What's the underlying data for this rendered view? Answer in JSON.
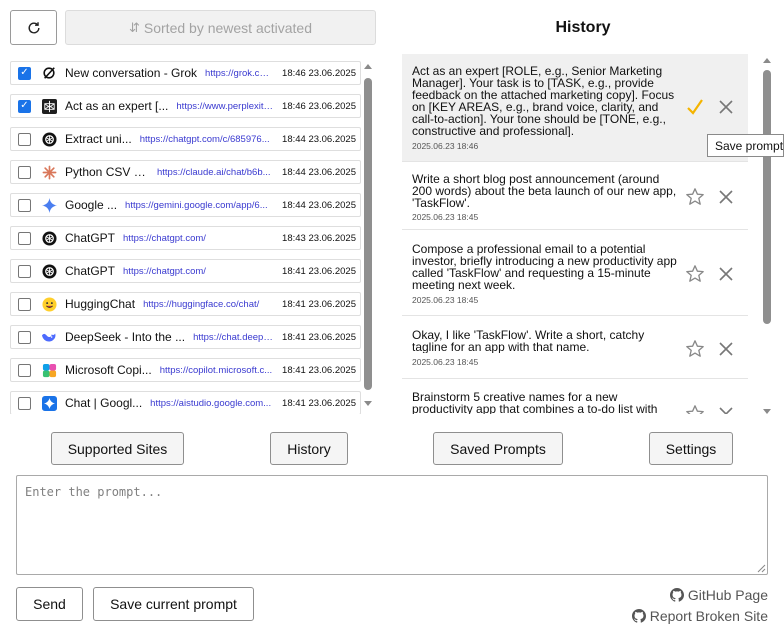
{
  "toolbar": {
    "refresh_icon": "refresh-icon",
    "sort_label": "Sorted by newest activated",
    "sort_icon": "sort-arrows-icon"
  },
  "tabs": [
    {
      "checked": true,
      "icon": "grok-logo-icon",
      "title": "New conversation - Grok",
      "url": "https://grok.com/",
      "time": "18:46 23.06.2025"
    },
    {
      "checked": true,
      "icon": "perplexity-logo-icon",
      "title": "Act as an expert [...",
      "url": "https://www.perplexity...",
      "time": "18:46 23.06.2025"
    },
    {
      "checked": false,
      "icon": "openai-logo-icon",
      "title": "Extract uni...",
      "url": "https://chatgpt.com/c/685976...",
      "time": "18:44 23.06.2025"
    },
    {
      "checked": false,
      "icon": "claude-logo-icon",
      "title": "Python CSV E...",
      "url": "https://claude.ai/chat/b6b...",
      "time": "18:44 23.06.2025"
    },
    {
      "checked": false,
      "icon": "gemini-logo-icon",
      "title": "Google ...",
      "url": "https://gemini.google.com/app/6...",
      "time": "18:44 23.06.2025"
    },
    {
      "checked": false,
      "icon": "openai-logo-icon",
      "title": "ChatGPT",
      "url": "https://chatgpt.com/",
      "time": "18:43 23.06.2025"
    },
    {
      "checked": false,
      "icon": "openai-logo-icon",
      "title": "ChatGPT",
      "url": "https://chatgpt.com/",
      "time": "18:41 23.06.2025"
    },
    {
      "checked": false,
      "icon": "huggingface-logo-icon",
      "title": "HuggingChat",
      "url": "https://huggingface.co/chat/",
      "time": "18:41 23.06.2025"
    },
    {
      "checked": false,
      "icon": "deepseek-logo-icon",
      "title": "DeepSeek - Into the ...",
      "url": "https://chat.deeps...",
      "time": "18:41 23.06.2025"
    },
    {
      "checked": false,
      "icon": "copilot-logo-icon",
      "title": "Microsoft Copi...",
      "url": "https://copilot.microsoft.c...",
      "time": "18:41 23.06.2025"
    },
    {
      "checked": false,
      "icon": "aistudio-logo-icon",
      "title": "Chat | Googl...",
      "url": "https://aistudio.google.com...",
      "time": "18:41 23.06.2025"
    }
  ],
  "history": {
    "title": "History",
    "items": [
      {
        "text": "Act as an expert [ROLE, e.g., Senior Marketing Manager]. Your task is to [TASK, e.g., provide feedback on the attached marketing copy]. Focus on [KEY AREAS, e.g., brand voice, clarity, and call-to-action]. Your tone should be [TONE, e.g., constructive and professional].",
        "date": "2025.06.23 18:46",
        "saved": true
      },
      {
        "text": "Write a short blog post announcement (around 200 words) about the beta launch of our new app, 'TaskFlow'.",
        "date": "2025.06.23 18:45",
        "saved": false
      },
      {
        "text": "Compose a professional email to a potential investor, briefly introducing a new productivity app called 'TaskFlow' and requesting a 15-minute meeting next week.",
        "date": "2025.06.23 18:45",
        "saved": false
      },
      {
        "text": "Okay, I like 'TaskFlow'. Write a short, catchy tagline for an app with that name.",
        "date": "2025.06.23 18:45",
        "saved": false
      },
      {
        "text": "Brainstorm 5 creative names for a new productivity app that combines a to-do list with",
        "date": "",
        "saved": false
      }
    ],
    "tooltip": "Save prompt",
    "accent_color": "#f4b400"
  },
  "nav": {
    "supported_sites": "Supported Sites",
    "history": "History",
    "saved_prompts": "Saved Prompts",
    "settings": "Settings"
  },
  "prompt": {
    "placeholder": "Enter the prompt...",
    "value": ""
  },
  "actions": {
    "send": "Send",
    "save_current": "Save current prompt"
  },
  "footer": {
    "github": "GitHub Page",
    "report": "Report Broken Site",
    "github_icon": "github-icon"
  }
}
